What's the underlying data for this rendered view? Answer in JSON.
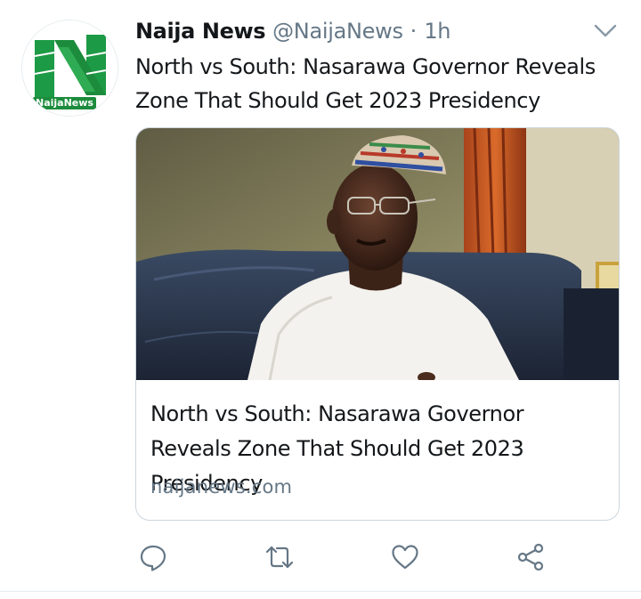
{
  "tweet": {
    "author": {
      "display_name": "Naija News",
      "handle": "@NaijaNews",
      "separator": "·",
      "time": "1h",
      "avatar_logo_text": "NaijaNews"
    },
    "text": "North vs South: Nasarawa Governor Reveals Zone That Should Get 2023 Presidency",
    "card": {
      "title": "North vs South: Nasarawa Governor Reveals Zone That Should Get 2023 Presidency",
      "domain": "naijanews.com"
    },
    "actions": [
      {
        "icon": "reply-icon"
      },
      {
        "icon": "retweet-icon"
      },
      {
        "icon": "like-icon"
      },
      {
        "icon": "share-icon"
      }
    ],
    "menu_icon": "chevron-down-icon"
  },
  "colors": {
    "text_primary": "#14171a",
    "text_secondary": "#657786",
    "border": "#ccd6dd",
    "brand_green": "#1c8c3c"
  }
}
